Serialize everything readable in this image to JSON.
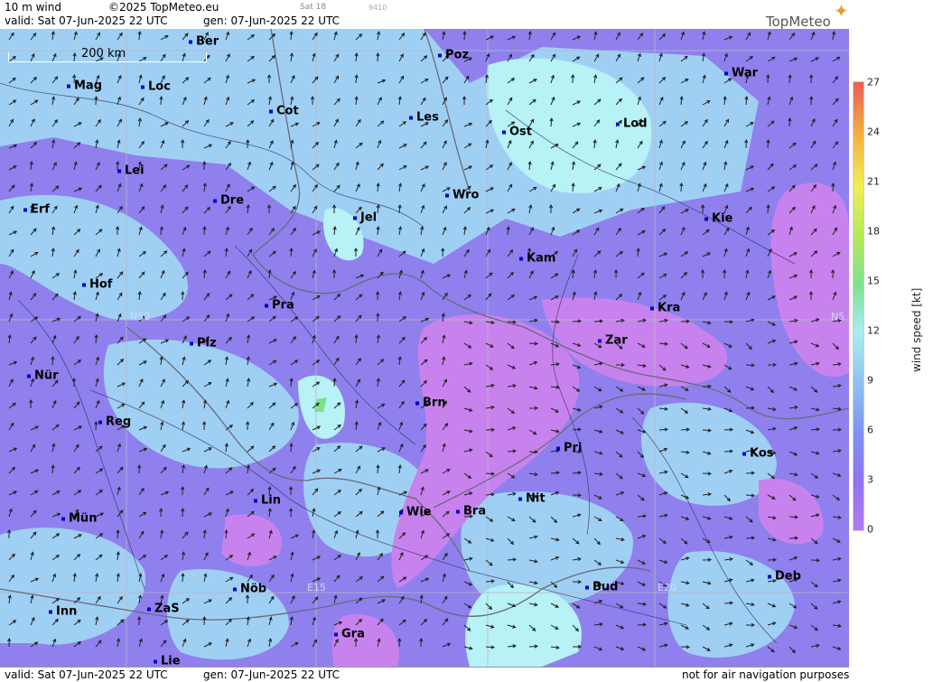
{
  "header": {
    "parameter": "10 m wind",
    "copyright": "©2025 TopMeteo.eu",
    "valid": "valid:  Sat  07-Jun-2025  22 UTC",
    "generated": "gen: 07-Jun-2025 22 UTC",
    "run_info": "Sat 18",
    "code": "9410",
    "brand": "TopMeteo"
  },
  "footer": {
    "valid": "valid:  Sat  07-Jun-2025  22 UTC",
    "generated": "gen: 07-Jun-2025 22 UTC",
    "disclaimer": "not for air navigation purposes"
  },
  "map": {
    "scale_label": "200 km",
    "grid_labels": [
      "N50",
      "N5",
      "E15",
      "E20"
    ],
    "cities": [
      "Ber",
      "Poz",
      "War",
      "Mag",
      "Loc",
      "Cot",
      "Les",
      "Ost",
      "Lod",
      "Lei",
      "Erf",
      "Dre",
      "Wro",
      "Jel",
      "Kie",
      "Kam",
      "Hof",
      "Pra",
      "Kra",
      "Zar",
      "Plz",
      "Nür",
      "Brn",
      "Reg",
      "Pri",
      "Kos",
      "Lin",
      "Nit",
      "Wie",
      "Bra",
      "Mün",
      "Deb",
      "Nöb",
      "Bud",
      "Inn",
      "ZaS",
      "Gra",
      "Lie"
    ]
  },
  "legend": {
    "ticks": [
      "27",
      "24",
      "21",
      "18",
      "15",
      "12",
      "9",
      "6",
      "3",
      "0"
    ],
    "unit_label": "wind  speed  [kt]"
  },
  "colors": {
    "background_violet": "#8f80ee",
    "light_blue": "#9fd0f4",
    "cyan": "#b6f2f6",
    "magenta": "#c882ee",
    "border": "#3a3a5a"
  }
}
